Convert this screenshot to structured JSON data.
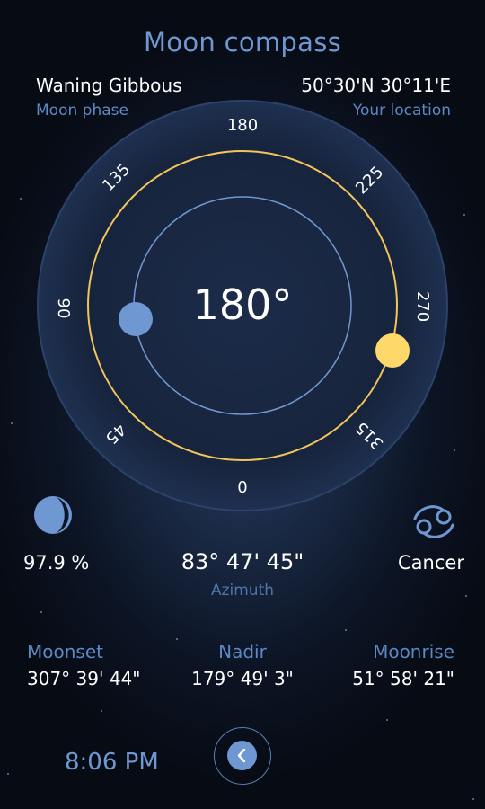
{
  "app": {
    "title": "Moon compass"
  },
  "phase": {
    "value": "Waning Gibbous",
    "label": "Moon phase"
  },
  "location": {
    "value": "50°30'N 30°11'E",
    "label": "Your location"
  },
  "compass": {
    "heading": "180°",
    "ticks": {
      "t0": "0",
      "t45": "45",
      "t90": "90",
      "t135": "135",
      "t180": "180",
      "t225": "225",
      "t270": "270",
      "t315": "315"
    },
    "colors": {
      "ring": "#f2c55a",
      "sun": "#ffd86a",
      "moon": "#6f98d3",
      "inner_circle": "#6f98d3"
    }
  },
  "moon": {
    "icon": "moon-phase-icon",
    "illumination": "97.9 %"
  },
  "azimuth": {
    "value": "83° 47' 45\"",
    "label": "Azimuth"
  },
  "zodiac": {
    "icon": "cancer-zodiac-icon",
    "label": "Cancer"
  },
  "events": {
    "moonset": {
      "label": "Moonset",
      "value": "307° 39' 44\""
    },
    "nadir": {
      "label": "Nadir",
      "value": "179° 49' 3\""
    },
    "moonrise": {
      "label": "Moonrise",
      "value": "51° 58' 21\""
    }
  },
  "footer": {
    "time": "8:06 PM",
    "back_icon": "chevron-left-icon"
  }
}
